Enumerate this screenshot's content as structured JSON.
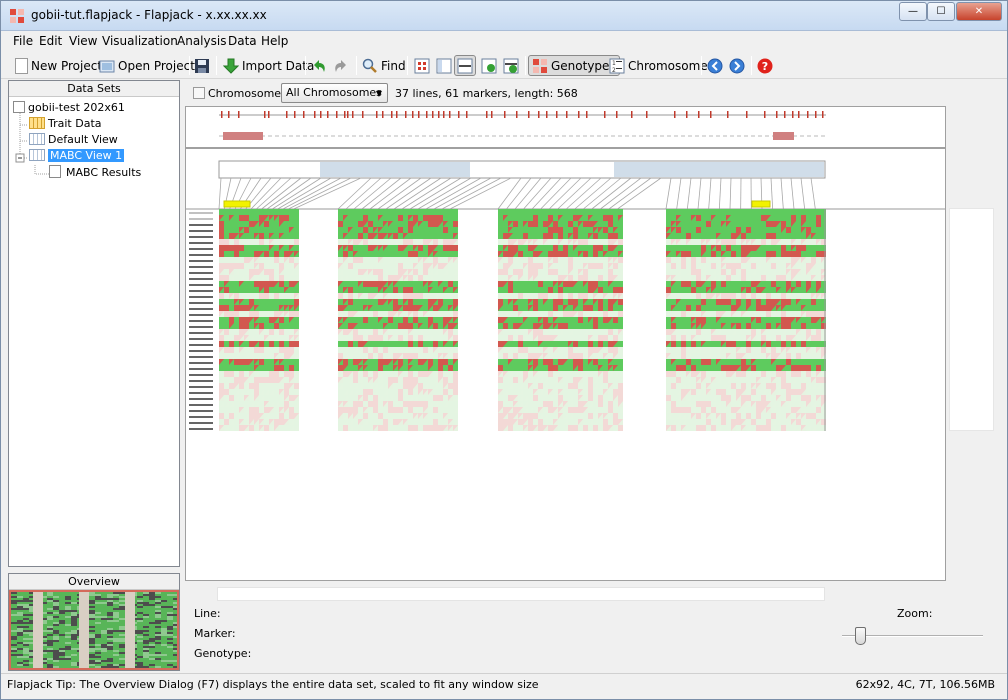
{
  "window": {
    "title": "gobii-tut.flapjack - Flapjack - x.xx.xx.xx",
    "controls": {
      "minimize": "—",
      "maximize": "☐",
      "close": "✕"
    }
  },
  "menu": [
    "File",
    "Edit",
    "View",
    "Visualization",
    "Analysis",
    "Data",
    "Help"
  ],
  "toolbar": {
    "new_project": "New Project",
    "open_project": "Open Project",
    "import_data": "Import Data",
    "find": "Find",
    "genotypes": "Genotypes",
    "chromosomes": "Chromosomes"
  },
  "datasets": {
    "header": "Data Sets",
    "root": "gobii-test 202x61",
    "items": [
      "Trait Data",
      "Default View",
      "MABC View 1",
      "MABC Results"
    ],
    "selected": "MABC View 1"
  },
  "overview": {
    "header": "Overview"
  },
  "chromosome_bar": {
    "label": "Chromosome:",
    "selected": "All Chromosomes",
    "info": "37 lines, 61 markers, length: 568"
  },
  "details": {
    "line_label": "Line:",
    "marker_label": "Marker:",
    "genotype_label": "Genotype:",
    "zoom_label": "Zoom:"
  },
  "status": {
    "tip": "Flapjack Tip:  The Overview Dialog (F7) displays the entire data set, scaled to fit any window size",
    "memory": "62x92, 4C, 7T, 106.56MB"
  },
  "colors": {
    "green": "#5ecb5e",
    "red": "#d2584f",
    "light_green": "#e4f5e2",
    "light_red": "#f3d9d6",
    "selection": "#3399ff",
    "highlight_yellow": "#f2f200"
  }
}
